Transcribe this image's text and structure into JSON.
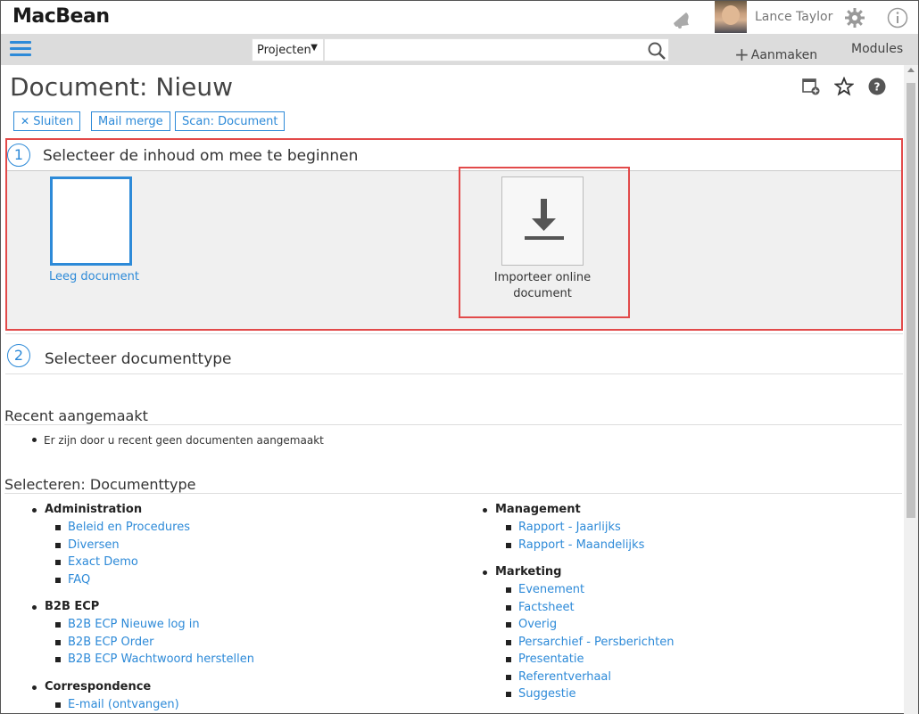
{
  "app": {
    "logo": "MacBean",
    "user_name": "Lance Taylor"
  },
  "nav": {
    "scope": "Projecten",
    "search_placeholder": "",
    "create_label": "Aanmaken",
    "modules_label": "Modules"
  },
  "page": {
    "title": "Document: Nieuw"
  },
  "actions": {
    "close": "Sluiten",
    "mail_merge": "Mail merge",
    "scan": "Scan: Document"
  },
  "step1": {
    "number": "1",
    "title": "Selecteer de inhoud om mee te beginnen",
    "empty_label": "Leeg document",
    "import_label": "Importeer online document"
  },
  "step2": {
    "number": "2",
    "title": "Selecteer documenttype"
  },
  "recent": {
    "title": "Recent aangemaakt",
    "empty_text": "Er zijn door u recent geen documenten aangemaakt"
  },
  "doctypes": {
    "title": "Selecteren: Documenttype",
    "left": [
      {
        "name": "Administration",
        "items": [
          "Beleid en Procedures",
          "Diversen",
          "Exact Demo",
          "FAQ"
        ]
      },
      {
        "name": "B2B ECP",
        "items": [
          "B2B ECP Nieuwe log in",
          "B2B ECP Order",
          "B2B ECP Wachtwoord herstellen"
        ]
      },
      {
        "name": "Correspondence",
        "items": [
          "E-mail (ontvangen)"
        ]
      }
    ],
    "right": [
      {
        "name": "Management",
        "items": [
          "Rapport - Jaarlijks",
          "Rapport - Maandelijks"
        ]
      },
      {
        "name": "Marketing",
        "items": [
          "Evenement",
          "Factsheet",
          "Overig",
          "Persarchief - Persberichten",
          "Presentatie",
          "Referentverhaal",
          "Suggestie"
        ]
      }
    ]
  },
  "colors": {
    "accent": "#2d8ad8",
    "highlight": "#e24a4a",
    "navbar": "#dcdcdc"
  }
}
